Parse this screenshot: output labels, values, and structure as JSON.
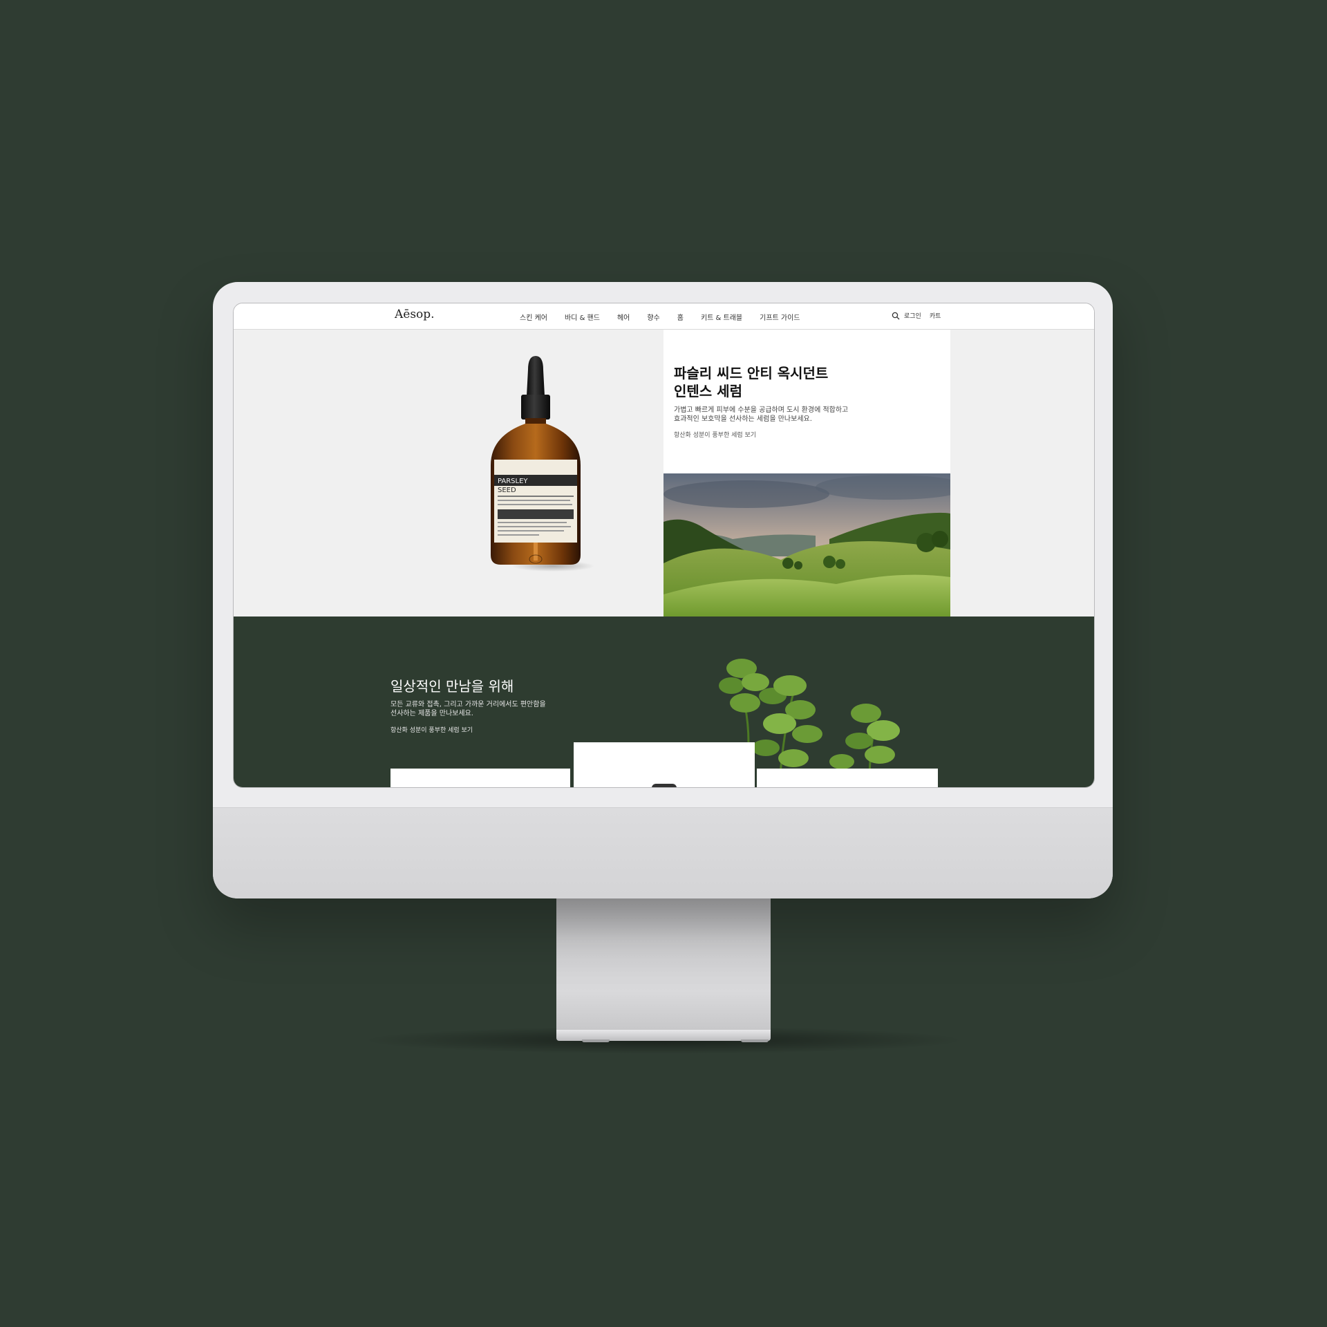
{
  "brand": {
    "logo": "Aēsop."
  },
  "nav": {
    "links": [
      "스킨 케어",
      "바디 & 핸드",
      "헤어",
      "향수",
      "홈",
      "키트 & 트래블",
      "기프트 가이드"
    ],
    "login": "로그인",
    "cart": "카트"
  },
  "hero": {
    "title_line1": "파슬리 씨드 안티 옥시던트",
    "title_line2": "인텐스 세럼",
    "desc_line1": "가볍고 빠르게 피부에 수분을 공급하며 도시 환경에 적합하고",
    "desc_line2": "효과적인 보호막을 선사하는 세럼을 만나보세요.",
    "link": "항산화 성분이 풍부한 세럼 보기"
  },
  "bottle_label": {
    "line1": "PARSLEY",
    "line2": "SEED"
  },
  "promo": {
    "title": "일상적인 만남을 위해",
    "desc_line1": "모든 교류와 접촉, 그리고 가까운 거리에서도 편안함을",
    "desc_line2": "선사하는 제품을 만나보세요.",
    "link": "항산화 성분이 풍부한 세럼 보기"
  },
  "colors": {
    "background": "#2f3c32",
    "promo_bg": "#2e3c30",
    "hero_bg": "#f0f0f0"
  }
}
